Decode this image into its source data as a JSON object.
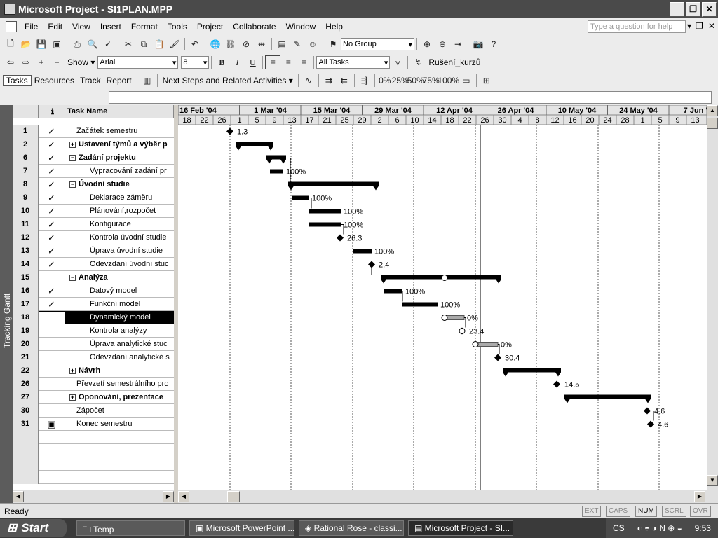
{
  "window": {
    "title": "Microsoft Project - SI1PLAN.MPP"
  },
  "menu": [
    "File",
    "Edit",
    "View",
    "Insert",
    "Format",
    "Tools",
    "Project",
    "Collaborate",
    "Window",
    "Help"
  ],
  "ask_placeholder": "Type a question for help",
  "toolbar1": {
    "group_value": "No Group"
  },
  "toolbar2": {
    "show_label": "Show ▾",
    "font": "Arial",
    "size": "8",
    "filter": "All Tasks",
    "resource": "Rušení_kurzů"
  },
  "toolbar3": {
    "tasks": "Tasks",
    "resources": "Resources",
    "track": "Track",
    "report": "Report",
    "next_steps": "Next Steps and Related Activities ▾",
    "pct": [
      "0%",
      "25%",
      "50%",
      "75%",
      "100%"
    ]
  },
  "viewbar_label": "Tracking Gantt",
  "table": {
    "headers": {
      "indicators": "ℹ",
      "task_name": "Task Name"
    },
    "rows": [
      {
        "id": "1",
        "check": true,
        "level": 1,
        "name": "Začátek semestru",
        "bold": false,
        "toggle": ""
      },
      {
        "id": "2",
        "check": true,
        "level": 0,
        "name": "Ustavení týmů a výběr p",
        "bold": true,
        "toggle": "+"
      },
      {
        "id": "6",
        "check": true,
        "level": 0,
        "name": "Zadání projektu",
        "bold": true,
        "toggle": "−"
      },
      {
        "id": "7",
        "check": true,
        "level": 2,
        "name": "Vypracování zadání pr",
        "bold": false,
        "toggle": ""
      },
      {
        "id": "8",
        "check": true,
        "level": 0,
        "name": "Úvodní studie",
        "bold": true,
        "toggle": "−"
      },
      {
        "id": "9",
        "check": true,
        "level": 2,
        "name": "Deklarace záměru",
        "bold": false,
        "toggle": ""
      },
      {
        "id": "10",
        "check": true,
        "level": 2,
        "name": "Plánování,rozpočet",
        "bold": false,
        "toggle": ""
      },
      {
        "id": "11",
        "check": true,
        "level": 2,
        "name": "Konfigurace",
        "bold": false,
        "toggle": ""
      },
      {
        "id": "12",
        "check": true,
        "level": 2,
        "name": "Kontrola úvodní studie",
        "bold": false,
        "toggle": ""
      },
      {
        "id": "13",
        "check": true,
        "level": 2,
        "name": "Úprava úvodní studie",
        "bold": false,
        "toggle": ""
      },
      {
        "id": "14",
        "check": true,
        "level": 2,
        "name": "Odevzdání úvodní stuc",
        "bold": false,
        "toggle": ""
      },
      {
        "id": "15",
        "check": false,
        "level": 0,
        "name": "Analýza",
        "bold": true,
        "toggle": "−"
      },
      {
        "id": "16",
        "check": true,
        "level": 2,
        "name": "Datový model",
        "bold": false,
        "toggle": ""
      },
      {
        "id": "17",
        "check": true,
        "level": 2,
        "name": "Funkční model",
        "bold": false,
        "toggle": ""
      },
      {
        "id": "18",
        "check": false,
        "level": 2,
        "name": "Dynamický model",
        "bold": false,
        "toggle": "",
        "selected": true
      },
      {
        "id": "19",
        "check": false,
        "level": 2,
        "name": "Kontrola analýzy",
        "bold": false,
        "toggle": ""
      },
      {
        "id": "20",
        "check": false,
        "level": 2,
        "name": "Úprava analytické stuc",
        "bold": false,
        "toggle": ""
      },
      {
        "id": "21",
        "check": false,
        "level": 2,
        "name": "Odevzdání analytické s",
        "bold": false,
        "toggle": ""
      },
      {
        "id": "22",
        "check": false,
        "level": 0,
        "name": "Návrh",
        "bold": true,
        "toggle": "+"
      },
      {
        "id": "26",
        "check": false,
        "level": 1,
        "name": "Převzetí semestrálního pro",
        "bold": false,
        "toggle": ""
      },
      {
        "id": "27",
        "check": false,
        "level": 0,
        "name": "Oponování, prezentace",
        "bold": true,
        "toggle": "+"
      },
      {
        "id": "30",
        "check": false,
        "level": 1,
        "name": "Zápočet",
        "bold": false,
        "toggle": ""
      },
      {
        "id": "31",
        "check": false,
        "level": 1,
        "name": "Konec semestru",
        "bold": false,
        "toggle": "",
        "calendar_icon": true
      }
    ]
  },
  "gantt": {
    "weeks": [
      "16 Feb '04",
      "1 Mar '04",
      "15 Mar '04",
      "29 Mar '04",
      "12 Apr '04",
      "26 Apr '04",
      "10 May '04",
      "24 May '04",
      "7 Jun '04"
    ],
    "days": [
      "18",
      "22",
      "26",
      "1",
      "5",
      "9",
      "13",
      "17",
      "21",
      "25",
      "29",
      "2",
      "6",
      "10",
      "14",
      "18",
      "22",
      "26",
      "30",
      "4",
      "8",
      "12",
      "16",
      "20",
      "24",
      "28",
      "1",
      "5",
      "9",
      "13"
    ],
    "labels": {
      "r1": "1.3",
      "r7": "100%",
      "r9": "100%",
      "r10": "100%",
      "r11": "100%",
      "r12": "26.3",
      "r13": "100%",
      "r14": "2.4",
      "r16": "100%",
      "r17": "100%",
      "r18": "0%",
      "r19": "23.4",
      "r20": "0%",
      "r21": "30.4",
      "r26": "14.5",
      "r30": "4.6",
      "r31": "4.6"
    }
  },
  "status": {
    "ready": "Ready",
    "ext": "EXT",
    "caps": "CAPS",
    "num": "NUM",
    "scrl": "SCRL",
    "ovr": "OVR"
  },
  "taskbar": {
    "start": "Start",
    "items": [
      "Temp",
      "Microsoft PowerPoint ...",
      "Rational Rose - classi...",
      "Microsoft Project - SI..."
    ],
    "lang": "CS",
    "time": "9:53"
  }
}
